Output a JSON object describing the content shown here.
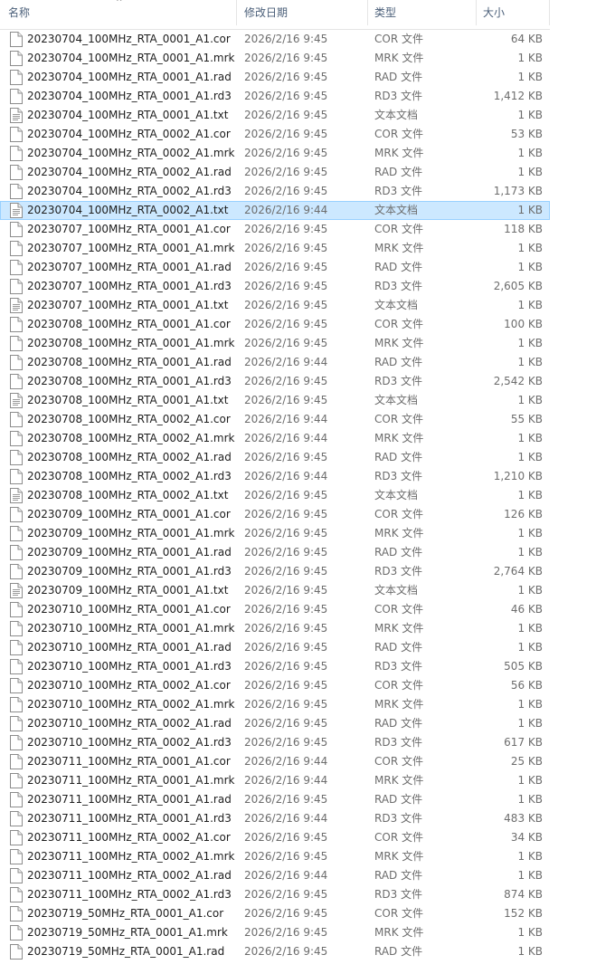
{
  "header": {
    "name": "名称",
    "date_modified": "修改日期",
    "type": "类型",
    "size": "大小"
  },
  "selected_index": 9,
  "files": [
    {
      "name": "20230704_100MHz_RTA_0001_A1.cor",
      "date": "2026/2/16 9:45",
      "type": "COR 文件",
      "size": "64 KB",
      "icon": "file-icon"
    },
    {
      "name": "20230704_100MHz_RTA_0001_A1.mrk",
      "date": "2026/2/16 9:45",
      "type": "MRK 文件",
      "size": "1 KB",
      "icon": "file-icon"
    },
    {
      "name": "20230704_100MHz_RTA_0001_A1.rad",
      "date": "2026/2/16 9:45",
      "type": "RAD 文件",
      "size": "1 KB",
      "icon": "file-icon"
    },
    {
      "name": "20230704_100MHz_RTA_0001_A1.rd3",
      "date": "2026/2/16 9:45",
      "type": "RD3 文件",
      "size": "1,412 KB",
      "icon": "file-icon"
    },
    {
      "name": "20230704_100MHz_RTA_0001_A1.txt",
      "date": "2026/2/16 9:45",
      "type": "文本文档",
      "size": "1 KB",
      "icon": "text-file-icon"
    },
    {
      "name": "20230704_100MHz_RTA_0002_A1.cor",
      "date": "2026/2/16 9:45",
      "type": "COR 文件",
      "size": "53 KB",
      "icon": "file-icon"
    },
    {
      "name": "20230704_100MHz_RTA_0002_A1.mrk",
      "date": "2026/2/16 9:45",
      "type": "MRK 文件",
      "size": "1 KB",
      "icon": "file-icon"
    },
    {
      "name": "20230704_100MHz_RTA_0002_A1.rad",
      "date": "2026/2/16 9:45",
      "type": "RAD 文件",
      "size": "1 KB",
      "icon": "file-icon"
    },
    {
      "name": "20230704_100MHz_RTA_0002_A1.rd3",
      "date": "2026/2/16 9:45",
      "type": "RD3 文件",
      "size": "1,173 KB",
      "icon": "file-icon"
    },
    {
      "name": "20230704_100MHz_RTA_0002_A1.txt",
      "date": "2026/2/16 9:44",
      "type": "文本文档",
      "size": "1 KB",
      "icon": "text-file-icon"
    },
    {
      "name": "20230707_100MHz_RTA_0001_A1.cor",
      "date": "2026/2/16 9:45",
      "type": "COR 文件",
      "size": "118 KB",
      "icon": "file-icon"
    },
    {
      "name": "20230707_100MHz_RTA_0001_A1.mrk",
      "date": "2026/2/16 9:45",
      "type": "MRK 文件",
      "size": "1 KB",
      "icon": "file-icon"
    },
    {
      "name": "20230707_100MHz_RTA_0001_A1.rad",
      "date": "2026/2/16 9:45",
      "type": "RAD 文件",
      "size": "1 KB",
      "icon": "file-icon"
    },
    {
      "name": "20230707_100MHz_RTA_0001_A1.rd3",
      "date": "2026/2/16 9:45",
      "type": "RD3 文件",
      "size": "2,605 KB",
      "icon": "file-icon"
    },
    {
      "name": "20230707_100MHz_RTA_0001_A1.txt",
      "date": "2026/2/16 9:45",
      "type": "文本文档",
      "size": "1 KB",
      "icon": "text-file-icon"
    },
    {
      "name": "20230708_100MHz_RTA_0001_A1.cor",
      "date": "2026/2/16 9:45",
      "type": "COR 文件",
      "size": "100 KB",
      "icon": "file-icon"
    },
    {
      "name": "20230708_100MHz_RTA_0001_A1.mrk",
      "date": "2026/2/16 9:45",
      "type": "MRK 文件",
      "size": "1 KB",
      "icon": "file-icon"
    },
    {
      "name": "20230708_100MHz_RTA_0001_A1.rad",
      "date": "2026/2/16 9:44",
      "type": "RAD 文件",
      "size": "1 KB",
      "icon": "file-icon"
    },
    {
      "name": "20230708_100MHz_RTA_0001_A1.rd3",
      "date": "2026/2/16 9:45",
      "type": "RD3 文件",
      "size": "2,542 KB",
      "icon": "file-icon"
    },
    {
      "name": "20230708_100MHz_RTA_0001_A1.txt",
      "date": "2026/2/16 9:45",
      "type": "文本文档",
      "size": "1 KB",
      "icon": "text-file-icon"
    },
    {
      "name": "20230708_100MHz_RTA_0002_A1.cor",
      "date": "2026/2/16 9:44",
      "type": "COR 文件",
      "size": "55 KB",
      "icon": "file-icon"
    },
    {
      "name": "20230708_100MHz_RTA_0002_A1.mrk",
      "date": "2026/2/16 9:44",
      "type": "MRK 文件",
      "size": "1 KB",
      "icon": "file-icon"
    },
    {
      "name": "20230708_100MHz_RTA_0002_A1.rad",
      "date": "2026/2/16 9:45",
      "type": "RAD 文件",
      "size": "1 KB",
      "icon": "file-icon"
    },
    {
      "name": "20230708_100MHz_RTA_0002_A1.rd3",
      "date": "2026/2/16 9:44",
      "type": "RD3 文件",
      "size": "1,210 KB",
      "icon": "file-icon"
    },
    {
      "name": "20230708_100MHz_RTA_0002_A1.txt",
      "date": "2026/2/16 9:45",
      "type": "文本文档",
      "size": "1 KB",
      "icon": "text-file-icon"
    },
    {
      "name": "20230709_100MHz_RTA_0001_A1.cor",
      "date": "2026/2/16 9:45",
      "type": "COR 文件",
      "size": "126 KB",
      "icon": "file-icon"
    },
    {
      "name": "20230709_100MHz_RTA_0001_A1.mrk",
      "date": "2026/2/16 9:45",
      "type": "MRK 文件",
      "size": "1 KB",
      "icon": "file-icon"
    },
    {
      "name": "20230709_100MHz_RTA_0001_A1.rad",
      "date": "2026/2/16 9:45",
      "type": "RAD 文件",
      "size": "1 KB",
      "icon": "file-icon"
    },
    {
      "name": "20230709_100MHz_RTA_0001_A1.rd3",
      "date": "2026/2/16 9:45",
      "type": "RD3 文件",
      "size": "2,764 KB",
      "icon": "file-icon"
    },
    {
      "name": "20230709_100MHz_RTA_0001_A1.txt",
      "date": "2026/2/16 9:45",
      "type": "文本文档",
      "size": "1 KB",
      "icon": "text-file-icon"
    },
    {
      "name": "20230710_100MHz_RTA_0001_A1.cor",
      "date": "2026/2/16 9:45",
      "type": "COR 文件",
      "size": "46 KB",
      "icon": "file-icon"
    },
    {
      "name": "20230710_100MHz_RTA_0001_A1.mrk",
      "date": "2026/2/16 9:45",
      "type": "MRK 文件",
      "size": "1 KB",
      "icon": "file-icon"
    },
    {
      "name": "20230710_100MHz_RTA_0001_A1.rad",
      "date": "2026/2/16 9:45",
      "type": "RAD 文件",
      "size": "1 KB",
      "icon": "file-icon"
    },
    {
      "name": "20230710_100MHz_RTA_0001_A1.rd3",
      "date": "2026/2/16 9:45",
      "type": "RD3 文件",
      "size": "505 KB",
      "icon": "file-icon"
    },
    {
      "name": "20230710_100MHz_RTA_0002_A1.cor",
      "date": "2026/2/16 9:45",
      "type": "COR 文件",
      "size": "56 KB",
      "icon": "file-icon"
    },
    {
      "name": "20230710_100MHz_RTA_0002_A1.mrk",
      "date": "2026/2/16 9:45",
      "type": "MRK 文件",
      "size": "1 KB",
      "icon": "file-icon"
    },
    {
      "name": "20230710_100MHz_RTA_0002_A1.rad",
      "date": "2026/2/16 9:45",
      "type": "RAD 文件",
      "size": "1 KB",
      "icon": "file-icon"
    },
    {
      "name": "20230710_100MHz_RTA_0002_A1.rd3",
      "date": "2026/2/16 9:45",
      "type": "RD3 文件",
      "size": "617 KB",
      "icon": "file-icon"
    },
    {
      "name": "20230711_100MHz_RTA_0001_A1.cor",
      "date": "2026/2/16 9:44",
      "type": "COR 文件",
      "size": "25 KB",
      "icon": "file-icon"
    },
    {
      "name": "20230711_100MHz_RTA_0001_A1.mrk",
      "date": "2026/2/16 9:44",
      "type": "MRK 文件",
      "size": "1 KB",
      "icon": "file-icon"
    },
    {
      "name": "20230711_100MHz_RTA_0001_A1.rad",
      "date": "2026/2/16 9:45",
      "type": "RAD 文件",
      "size": "1 KB",
      "icon": "file-icon"
    },
    {
      "name": "20230711_100MHz_RTA_0001_A1.rd3",
      "date": "2026/2/16 9:44",
      "type": "RD3 文件",
      "size": "483 KB",
      "icon": "file-icon"
    },
    {
      "name": "20230711_100MHz_RTA_0002_A1.cor",
      "date": "2026/2/16 9:45",
      "type": "COR 文件",
      "size": "34 KB",
      "icon": "file-icon"
    },
    {
      "name": "20230711_100MHz_RTA_0002_A1.mrk",
      "date": "2026/2/16 9:45",
      "type": "MRK 文件",
      "size": "1 KB",
      "icon": "file-icon"
    },
    {
      "name": "20230711_100MHz_RTA_0002_A1.rad",
      "date": "2026/2/16 9:44",
      "type": "RAD 文件",
      "size": "1 KB",
      "icon": "file-icon"
    },
    {
      "name": "20230711_100MHz_RTA_0002_A1.rd3",
      "date": "2026/2/16 9:45",
      "type": "RD3 文件",
      "size": "874 KB",
      "icon": "file-icon"
    },
    {
      "name": "20230719_50MHz_RTA_0001_A1.cor",
      "date": "2026/2/16 9:45",
      "type": "COR 文件",
      "size": "152 KB",
      "icon": "file-icon"
    },
    {
      "name": "20230719_50MHz_RTA_0001_A1.mrk",
      "date": "2026/2/16 9:45",
      "type": "MRK 文件",
      "size": "1 KB",
      "icon": "file-icon"
    },
    {
      "name": "20230719_50MHz_RTA_0001_A1.rad",
      "date": "2026/2/16 9:45",
      "type": "RAD 文件",
      "size": "1 KB",
      "icon": "file-icon"
    }
  ]
}
